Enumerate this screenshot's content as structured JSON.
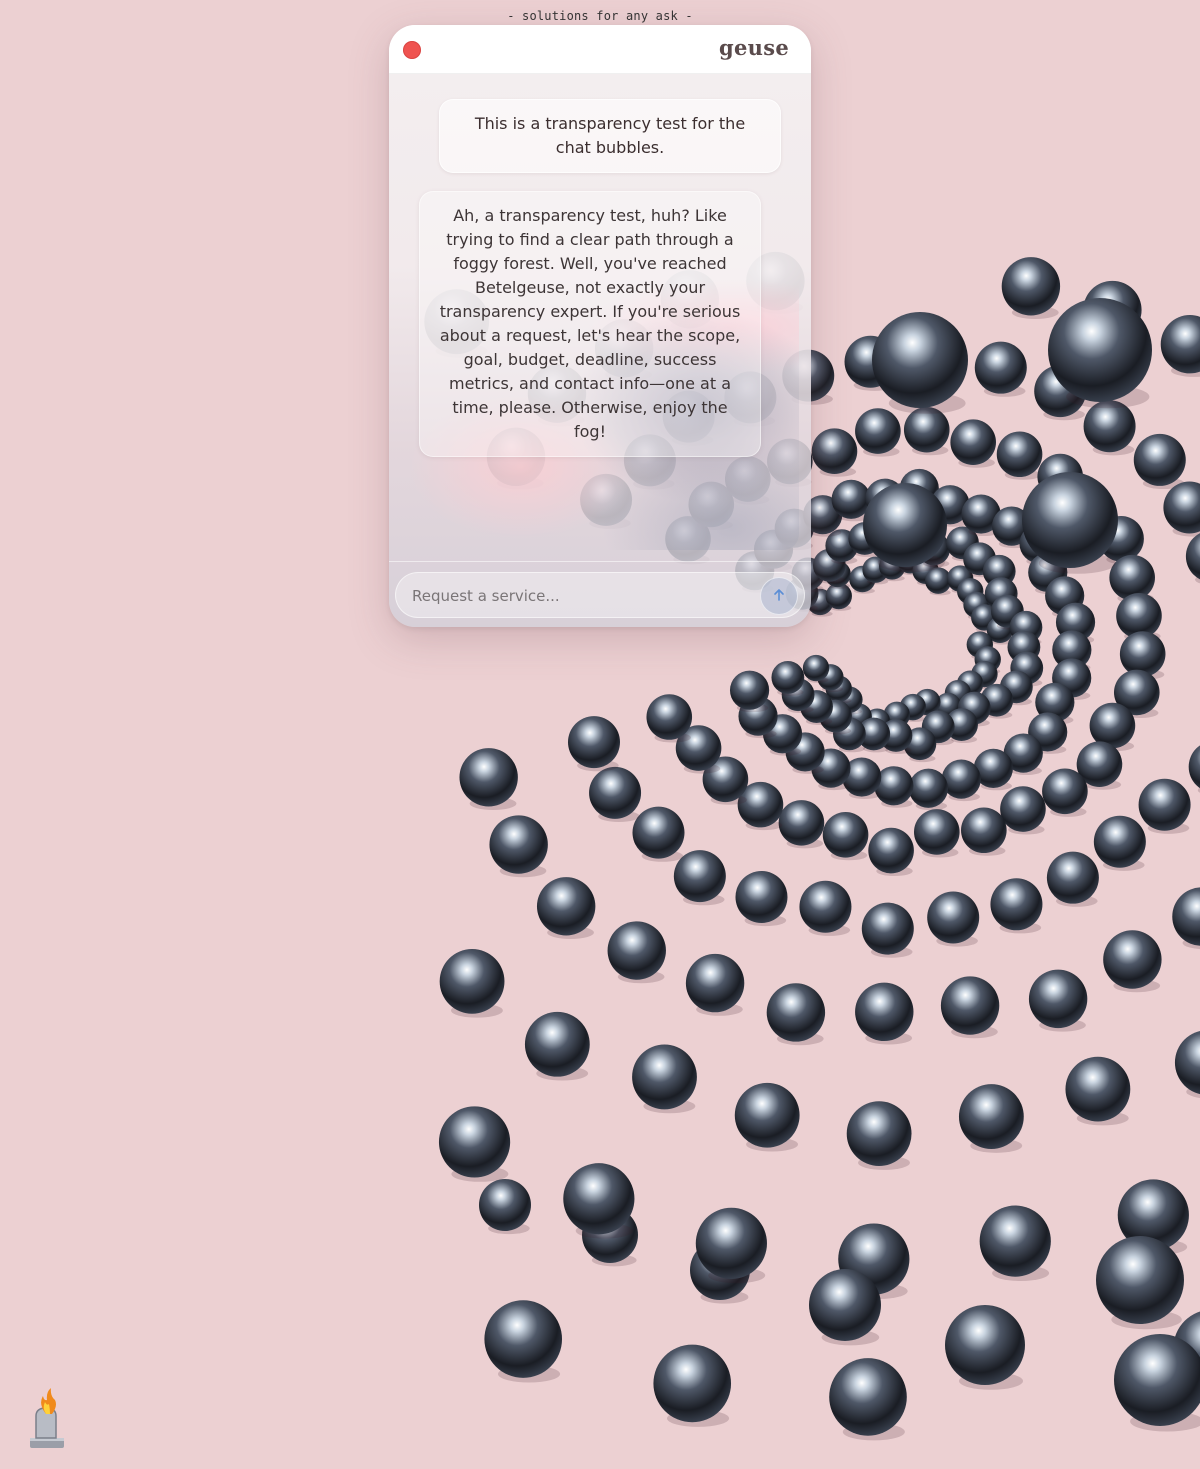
{
  "page": {
    "tagline": "- solutions for any ask -",
    "background_color": "#ecd0d2"
  },
  "window": {
    "brand": "geuse",
    "close_color": "#ef5350"
  },
  "messages": [
    {
      "role": "user",
      "text": "This is a transparency test for the chat bubbles."
    },
    {
      "role": "assistant",
      "text": "Ah, a transparency test, huh? Like trying to find a clear path through a foggy forest. Well, you've reached Betelgeuse, not exactly your transparency expert. If you're serious about a request, let's hear the scope, goal, budget, deadline, success metrics, and contact info—one at a time, please. Otherwise, enjoy the fog!"
    }
  ],
  "composer": {
    "placeholder": "Request a service...",
    "value": "",
    "send_icon": "arrow-up-icon"
  },
  "decor": {
    "background_art": "metallic-spheres-field",
    "corner_icon": "flaming-tombstone-icon",
    "sphere_color": "#1c1f26"
  }
}
